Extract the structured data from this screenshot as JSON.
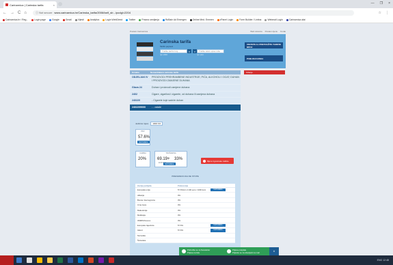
{
  "browser": {
    "tab_title": "Carinarnica | Carinska tarifa",
    "tab_close": "×",
    "window_controls": [
      "—",
      "❐",
      "×"
    ],
    "nav": [
      "←",
      "→",
      "C",
      "⌂"
    ],
    "security": "ⓘ Not secure",
    "url": "www.carinarnica.hr/Carinska_tarifa/2006/tarif_sb.../podgl=2204",
    "right_icons": [
      "☆",
      "⋮"
    ],
    "bookmarks": [
      {
        "label": "Carinarnica.hr / Reg...",
        "color": "#d32f2f"
      },
      {
        "label": "Login page",
        "color": "#e53935"
      },
      {
        "label": "Google",
        "color": "#4285f4"
      },
      {
        "label": "Gmail",
        "color": "#d93025"
      },
      {
        "label": "Vijesti",
        "color": "#888888"
      },
      {
        "label": "Analytics",
        "color": "#f57c00"
      },
      {
        "label": "Login WebDirect",
        "color": "#f9a825"
      },
      {
        "label": "Twitter",
        "color": "#1da1f2"
      },
      {
        "label": "Pravna uredjenja",
        "color": "#4caf50"
      },
      {
        "label": "RuBain Ad Emergen",
        "color": "#1e88e5"
      },
      {
        "label": "Online Med. Emmen",
        "color": "#333333"
      },
      {
        "label": "cPanel Login",
        "color": "#ff6f00"
      },
      {
        "label": "Form Builder / Lintina",
        "color": "#fb8c00"
      },
      {
        "label": "Webmail Login",
        "color": "#9e9e9e"
      },
      {
        "label": "Carinarnica alat",
        "color": "#3949ab"
      }
    ]
  },
  "top_links": {
    "left": "Postani Carinarnica",
    "right": [
      "Web stranica",
      "Postavi cijenu",
      "Korak"
    ]
  },
  "header": {
    "title": "Carinska tarifa",
    "subtitle": "Tarifni pojmovi",
    "search1_placeholder": "Tražite tarifni broj",
    "search1_hint": "npr. 2204",
    "search2_placeholder": "Tražite tekst opisa robe",
    "search2_hint": "npr. pivo",
    "search_icon": "⌕",
    "btn1": "UNOSITE ILI PRETRAŽITE TARIFNI BROJ",
    "btn2": "PUBLIKACIJSKA"
  },
  "sidebar": {
    "title": "Izdanje"
  },
  "table": {
    "col1": "Oznaka",
    "col2": "Nomenklatura carinske tarife",
    "rows": [
      {
        "code": "ODJELJAK IV",
        "desc": "PROIZVODI PREHRAMBENE INDUSTRIJE; PIĆA, ALKOHOLI I OCAT; DUHAN I PROIZVODI ZAMJENE DUHANA",
        "hl": false
      },
      {
        "code": "Glava 24",
        "desc": "Duhan i proizvodi zamjene duhana",
        "hl": false
      },
      {
        "code": "2402",
        "desc": "Cigare, cigarilosi i cigarete, od duhana ili zamjena duhana",
        "hl": false
      },
      {
        "code": "240220",
        "desc": "- Cigarete koje sadrže duhan",
        "hl": false
      },
      {
        "code": "2402209000",
        "desc": "- - ostale",
        "hl": true
      }
    ]
  },
  "calc": {
    "amount_label": "Jedinica mjere",
    "amount_value": "1000 KO",
    "box1_label": "PDV",
    "box1_value": "57.6%",
    "box1_btn": "NAPOMENA",
    "box2_label": "CARINA",
    "box2_value": "20%",
    "box3_label": "TROŠARINA",
    "box3_value1": "69.19+",
    "box3_sub": "EUR/1000",
    "box3_value2": "33%",
    "box3_btn": "NAPOMENA",
    "red_btn_icon": "!",
    "red_btn": "Mjere trgovinske zaštite"
  },
  "pref": {
    "title": "PREFERENCIJALNE STOPE",
    "headers": [
      "Zemlja podrijetla",
      "Preferencija",
      ""
    ],
    "rows": [
      {
        "country": "Europska unija",
        "rate": "57.6%min 4 100 euro / 1000 kom",
        "btn": "NAPOMENA"
      },
      {
        "country": "Albanija",
        "rate": "0%",
        "btn": ""
      },
      {
        "country": "Bosna i Hercegovina",
        "rate": "0%",
        "btn": ""
      },
      {
        "country": "Crna Gora",
        "rate": "0%",
        "btn": ""
      },
      {
        "country": "Makedonija",
        "rate": "0%",
        "btn": ""
      },
      {
        "country": "Moldavija",
        "rate": "0%",
        "btn": ""
      },
      {
        "country": "OMIRS/Kosovo",
        "rate": "0%",
        "btn": ""
      },
      {
        "country": "Europska zajednica",
        "rate": "57.6%",
        "btn": "NAPOMENA"
      },
      {
        "country": "Island",
        "rate": "57.6%",
        "btn": "NAPOMENA"
      },
      {
        "country": "Norveška",
        "rate": "",
        "btn": ""
      },
      {
        "country": "Švicarska",
        "rate": "",
        "btn": ""
      }
    ]
  },
  "notification": {
    "left": "Pridružite se za Newsletter",
    "left_sub": "Prijava na listu",
    "right": "Prijava pretplate",
    "right_sub": "Prijavite se za obavijesti na mail",
    "close": "✕"
  },
  "taskbar": {
    "icons": [
      {
        "name": "explorer-icon",
        "color": "#3b78c9"
      },
      {
        "name": "mail-icon",
        "color": "#e0e0e0"
      },
      {
        "name": "chrome-icon",
        "color": "#fbbc05"
      },
      {
        "name": "files-icon",
        "color": "#ffcc4d"
      },
      {
        "name": "excel-icon",
        "color": "#217346"
      },
      {
        "name": "word-icon",
        "color": "#2b579a"
      },
      {
        "name": "outlook-icon",
        "color": "#0072c6"
      },
      {
        "name": "powerpoint-icon",
        "color": "#d24726"
      },
      {
        "name": "onenote-icon",
        "color": "#7719aa"
      },
      {
        "name": "app-icon",
        "color": "#c62828"
      }
    ],
    "tray": "ENG  12:48"
  }
}
